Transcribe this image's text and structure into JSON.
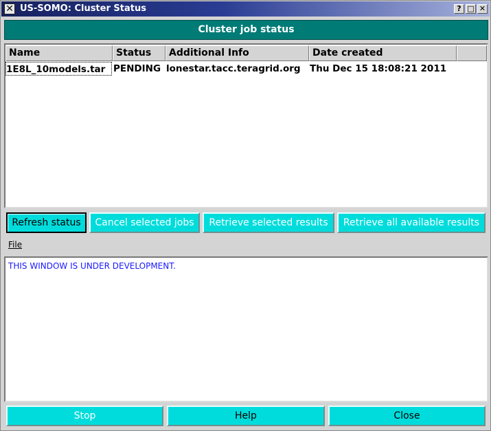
{
  "window": {
    "title": "US-SOMO: Cluster Status",
    "icon": "x-icon",
    "controls": {
      "help": "?",
      "maximize": "□",
      "close": "✕"
    }
  },
  "header": {
    "title": "Cluster job status"
  },
  "jobs_table": {
    "columns": [
      "Name",
      "Status",
      "Additional Info",
      "Date created"
    ],
    "rows": [
      {
        "name": "1E8L_10models.tar",
        "status": "PENDING",
        "info": "lonestar.tacc.teragrid.org",
        "date": "Thu Dec 15 18:08:21 2011"
      }
    ]
  },
  "actions": {
    "refresh": "Refresh status",
    "cancel": "Cancel selected jobs",
    "retrieve_selected": "Retrieve selected results",
    "retrieve_all": "Retrieve all available results"
  },
  "menu": {
    "file": "File"
  },
  "log": {
    "message": "THIS WINDOW IS UNDER DEVELOPMENT."
  },
  "footer": {
    "stop": "Stop",
    "help": "Help",
    "close": "Close"
  },
  "colors": {
    "header_bg": "#007b76",
    "button_bg": "#00dcdc",
    "log_text": "#1919ff",
    "titlebar_start": "#16215e"
  }
}
